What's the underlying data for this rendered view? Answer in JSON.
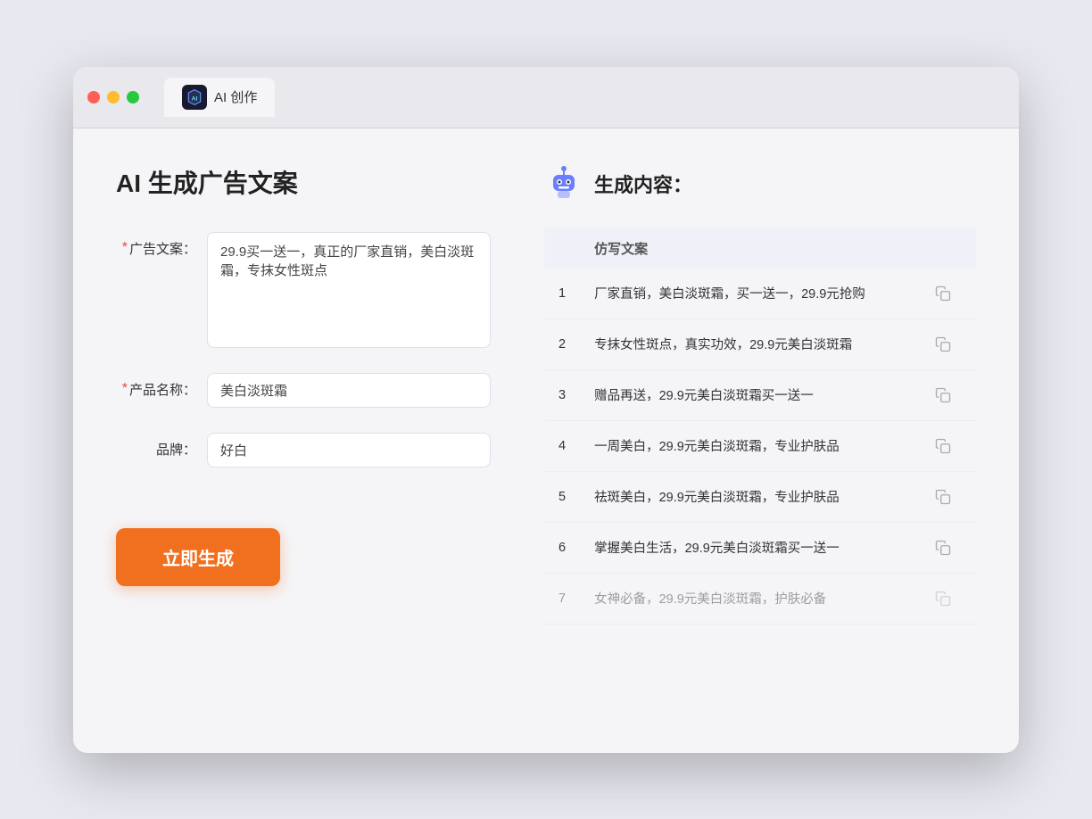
{
  "window": {
    "tab_label": "AI 创作"
  },
  "left": {
    "title": "AI 生成广告文案",
    "form": {
      "ad_copy_label": "广告文案：",
      "ad_copy_required": "*",
      "ad_copy_value": "29.9买一送一，真正的厂家直销，美白淡斑霜，专抹女性斑点",
      "product_label": "产品名称：",
      "product_required": "*",
      "product_value": "美白淡斑霜",
      "brand_label": "品牌：",
      "brand_required": "",
      "brand_value": "好白",
      "generate_button": "立即生成"
    }
  },
  "right": {
    "title": "生成内容：",
    "table_header": "仿写文案",
    "results": [
      {
        "num": "1",
        "text": "厂家直销，美白淡斑霜，买一送一，29.9元抢购"
      },
      {
        "num": "2",
        "text": "专抹女性斑点，真实功效，29.9元美白淡斑霜"
      },
      {
        "num": "3",
        "text": "赠品再送，29.9元美白淡斑霜买一送一"
      },
      {
        "num": "4",
        "text": "一周美白，29.9元美白淡斑霜，专业护肤品"
      },
      {
        "num": "5",
        "text": "祛斑美白，29.9元美白淡斑霜，专业护肤品"
      },
      {
        "num": "6",
        "text": "掌握美白生活，29.9元美白淡斑霜买一送一"
      },
      {
        "num": "7",
        "text": "女神必备，29.9元美白淡斑霜，护肤必备"
      }
    ]
  }
}
